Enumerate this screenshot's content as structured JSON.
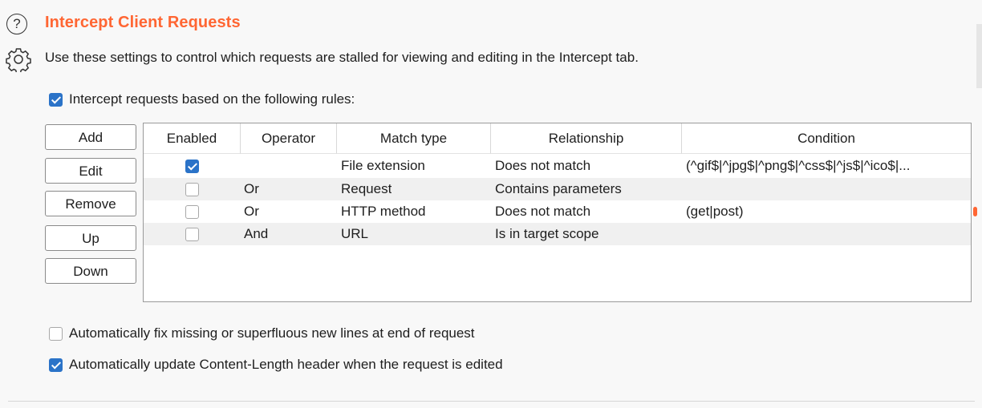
{
  "section": {
    "title": "Intercept Client Requests",
    "description": "Use these settings to control which requests are stalled for viewing and editing in the Intercept tab.",
    "title_color": "#ff6633"
  },
  "intercept_rules_toggle": {
    "label": "Intercept requests based on the following rules:",
    "checked": true
  },
  "buttons": {
    "add": "Add",
    "edit": "Edit",
    "remove": "Remove",
    "up": "Up",
    "down": "Down"
  },
  "table": {
    "headers": {
      "enabled": "Enabled",
      "operator": "Operator",
      "match_type": "Match type",
      "relationship": "Relationship",
      "condition": "Condition"
    },
    "rows": [
      {
        "enabled": true,
        "operator": "",
        "match_type": "File extension",
        "relationship": "Does not match",
        "condition": "(^gif$|^jpg$|^png$|^css$|^js$|^ico$|..."
      },
      {
        "enabled": false,
        "operator": "Or",
        "match_type": "Request",
        "relationship": "Contains parameters",
        "condition": ""
      },
      {
        "enabled": false,
        "operator": "Or",
        "match_type": "HTTP method",
        "relationship": "Does not match",
        "condition": "(get|post)"
      },
      {
        "enabled": false,
        "operator": "And",
        "match_type": "URL",
        "relationship": "Is in target scope",
        "condition": ""
      }
    ]
  },
  "options": {
    "fix_newlines": {
      "label": "Automatically fix missing or superfluous new lines at end of request",
      "checked": false
    },
    "update_content_length": {
      "label": "Automatically update Content-Length header when the request is edited",
      "checked": true
    }
  },
  "icons": {
    "help": "help-circle-icon",
    "settings": "gear-icon"
  },
  "accent_color": "#2b73c8"
}
